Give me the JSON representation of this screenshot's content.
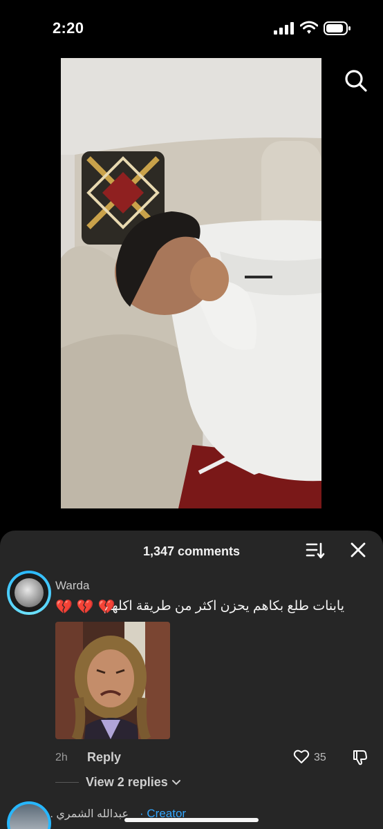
{
  "status_bar": {
    "time": "2:20",
    "icons": [
      "cellular-signal-icon",
      "wifi-icon",
      "battery-icon"
    ]
  },
  "video": {
    "description_icon": "video-frame",
    "search_icon": "search-icon"
  },
  "comments_sheet": {
    "title": "1,347 comments",
    "sort_icon": "sort-icon",
    "close_icon": "close-icon",
    "comments": [
      {
        "username": "Warda",
        "text": "يابنات طلع بكاهم يحزن اكثر من طريقة اكلهم",
        "emoji": "💔💔💔",
        "has_image": true,
        "time": "2h",
        "reply_label": "Reply",
        "likes": "35",
        "view_replies": "View 2 replies"
      },
      {
        "username": "عبدالله الشمري .",
        "badge": "· Creator"
      }
    ]
  },
  "colors": {
    "accent": "#33a7ff",
    "sheet_bg": "#262626",
    "avatar_ring": "#27b7ff"
  }
}
